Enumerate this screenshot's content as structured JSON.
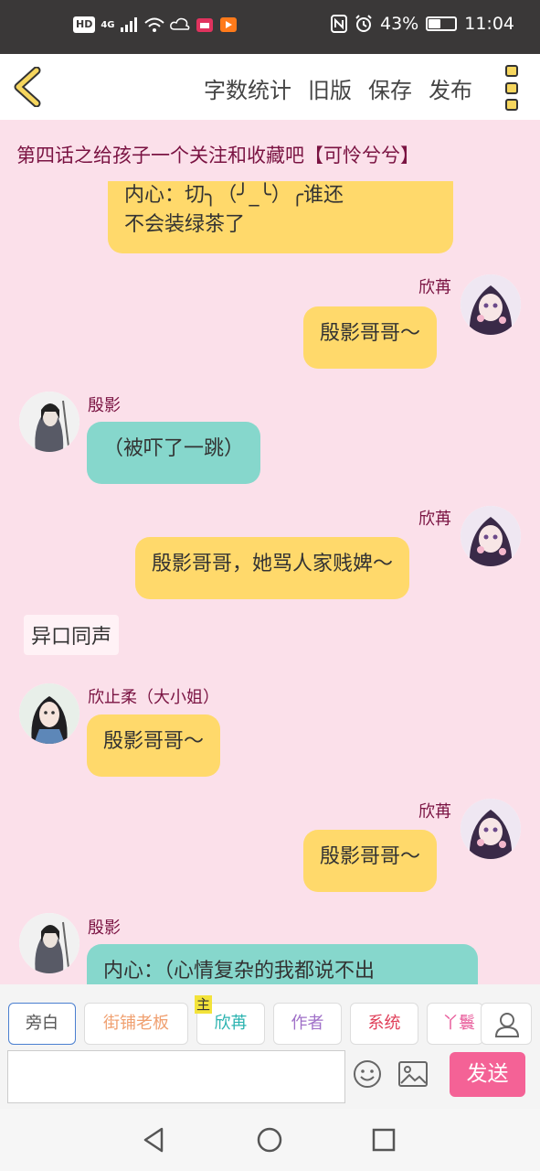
{
  "status_bar": {
    "hd": "HD",
    "signal": "4G",
    "battery": "43%",
    "battery_level": 0.43,
    "time": "11:04"
  },
  "toolbar": {
    "word_count": "字数统计",
    "old_version": "旧版",
    "save": "保存",
    "publish": "发布"
  },
  "chapter_title": "第四话之给孩子一个关注和收藏吧【可怜兮兮】",
  "messages": {
    "m0_text1": "内心：切╮（╯_╰）╭谁还",
    "m0_text2": "不会装绿茶了",
    "m1_name": "欣苒",
    "m1_text": "殷影哥哥～",
    "m2_name": "殷影",
    "m2_text": "（被吓了一跳）",
    "m3_name": "欣苒",
    "m3_text": "殷影哥哥，她骂人家贱婢～",
    "narration": "异口同声",
    "m4_name": "欣止柔（大小姐）",
    "m4_text": "殷影哥哥～",
    "m5_name": "欣苒",
    "m5_text": "殷影哥哥～",
    "m6_name": "殷影",
    "m6_text": "内心：（心情复杂的我都说不出"
  },
  "roles": {
    "narrator": "旁白",
    "shop_owner": "街铺老板",
    "main_badge": "主",
    "xinran": "欣苒",
    "author": "作者",
    "system": "系统",
    "maid": "丫鬟"
  },
  "composer": {
    "send": "发送"
  },
  "colors": {
    "background": "#fbe0ea",
    "yellow_bubble": "#ffd96b",
    "teal_bubble": "#86d7cc",
    "send_button": "#f46296",
    "name_color": "#7a1342"
  }
}
